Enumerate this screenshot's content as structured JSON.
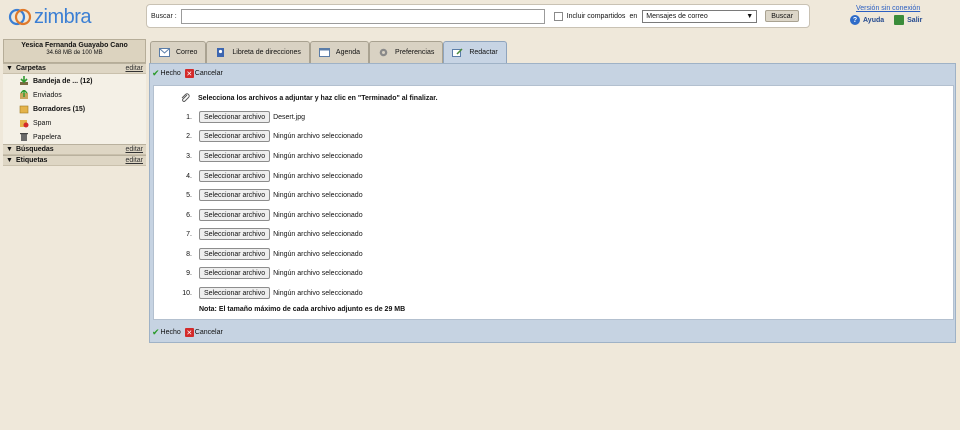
{
  "app": {
    "logo_text": "zimbra"
  },
  "search": {
    "label": "Buscar :",
    "value": "",
    "include_shared_label": "Incluir compartidos",
    "in_label": "en",
    "scope_selected": "Mensajes de correo",
    "button_label": "Buscar"
  },
  "top_links": {
    "offline": "Versión sin conexión",
    "help": "Ayuda",
    "logout": "Salir"
  },
  "user": {
    "name": "Yesica Fernanda Guayabo Cano",
    "quota": "34.68 MB de 100 MB"
  },
  "sidebar": {
    "folders_title": "Carpetas",
    "edit_label": "editar",
    "folders": [
      {
        "label": "Bandeja de ... (12)",
        "icon": "inbox-icon",
        "bold": true
      },
      {
        "label": "Enviados",
        "icon": "sent-icon",
        "bold": false
      },
      {
        "label": "Borradores (15)",
        "icon": "drafts-icon",
        "bold": true
      },
      {
        "label": "Spam",
        "icon": "spam-icon",
        "bold": false
      },
      {
        "label": "Papelera",
        "icon": "trash-icon",
        "bold": false
      }
    ],
    "searches_title": "Búsquedas",
    "tags_title": "Etiquetas"
  },
  "tabs": [
    {
      "label": "Correo",
      "icon": "mail-icon",
      "active": false
    },
    {
      "label": "Libreta de direcciones",
      "icon": "addressbook-icon",
      "active": false
    },
    {
      "label": "Agenda",
      "icon": "calendar-icon",
      "active": false
    },
    {
      "label": "Preferencias",
      "icon": "gear-icon",
      "active": false
    },
    {
      "label": "Redactar",
      "icon": "compose-icon",
      "active": true
    }
  ],
  "toolbar": {
    "done_label": "Hecho",
    "cancel_label": "Cancelar"
  },
  "attach": {
    "instruction": "Selecciona los archivos a adjuntar y haz clic en \"Terminado\" al finalizar.",
    "button_label": "Seleccionar archivo",
    "rows": [
      {
        "num": "1.",
        "file": "Desert.jpg"
      },
      {
        "num": "2.",
        "file": "Ningún archivo seleccionado"
      },
      {
        "num": "3.",
        "file": "Ningún archivo seleccionado"
      },
      {
        "num": "4.",
        "file": "Ningún archivo seleccionado"
      },
      {
        "num": "5.",
        "file": "Ningún archivo seleccionado"
      },
      {
        "num": "6.",
        "file": "Ningún archivo seleccionado"
      },
      {
        "num": "7.",
        "file": "Ningún archivo seleccionado"
      },
      {
        "num": "8.",
        "file": "Ningún archivo seleccionado"
      },
      {
        "num": "9.",
        "file": "Ningún archivo seleccionado"
      },
      {
        "num": "10.",
        "file": "Ningún archivo seleccionado"
      }
    ],
    "note": "Nota: El tamaño máximo de cada archivo adjunto es de 29 MB"
  },
  "colors": {
    "accent": "#3b7fd4",
    "panel": "#c6d3e2",
    "background": "#efe8da"
  }
}
